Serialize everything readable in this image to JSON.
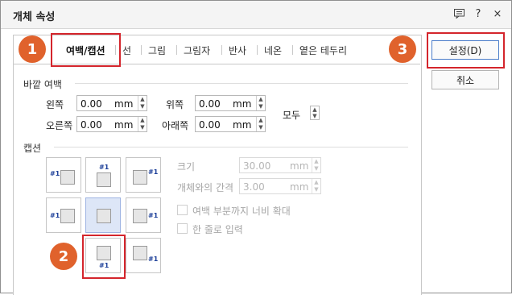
{
  "window": {
    "title": "개체 속성"
  },
  "titlebar_icons": [
    "comment-icon",
    "help-icon",
    "close-icon"
  ],
  "titlebar_glyphs": {
    "help": "?",
    "close": "×"
  },
  "tabs": [
    {
      "label": "여백/캡션",
      "active": true
    },
    {
      "label": "선"
    },
    {
      "label": "그림"
    },
    {
      "label": "그림자"
    },
    {
      "label": "반사"
    },
    {
      "label": "네온"
    },
    {
      "label": "옅은 테두리"
    }
  ],
  "buttons": {
    "ok": "설정(D)",
    "cancel": "취소"
  },
  "outer_margin": {
    "title": "바깥 여백",
    "left": {
      "label": "왼쪽",
      "value": "0.00",
      "unit": "mm"
    },
    "right": {
      "label": "오른쪽",
      "value": "0.00",
      "unit": "mm"
    },
    "top": {
      "label": "위쪽",
      "value": "0.00",
      "unit": "mm"
    },
    "bottom": {
      "label": "아래쪽",
      "value": "0.00",
      "unit": "mm"
    },
    "all_label": "모두"
  },
  "caption": {
    "title": "캡션",
    "marker": "#1",
    "selected": "none",
    "size": {
      "label": "크기",
      "value": "30.00",
      "unit": "mm"
    },
    "gap": {
      "label": "개체와의 간격",
      "value": "3.00",
      "unit": "mm"
    },
    "expand_to_margin": {
      "label": "여백 부분까지 너비 확대",
      "checked": false
    },
    "single_line": {
      "label": "한 줄로 입력",
      "checked": false
    }
  },
  "annotations": {
    "badge1": "1",
    "badge2": "2",
    "badge3": "3"
  },
  "colors": {
    "annotation_red": "#d4252c",
    "badge_orange": "#e0622c",
    "caption_mark": "#1c3f99",
    "selected_cell": "#dde6f7"
  }
}
